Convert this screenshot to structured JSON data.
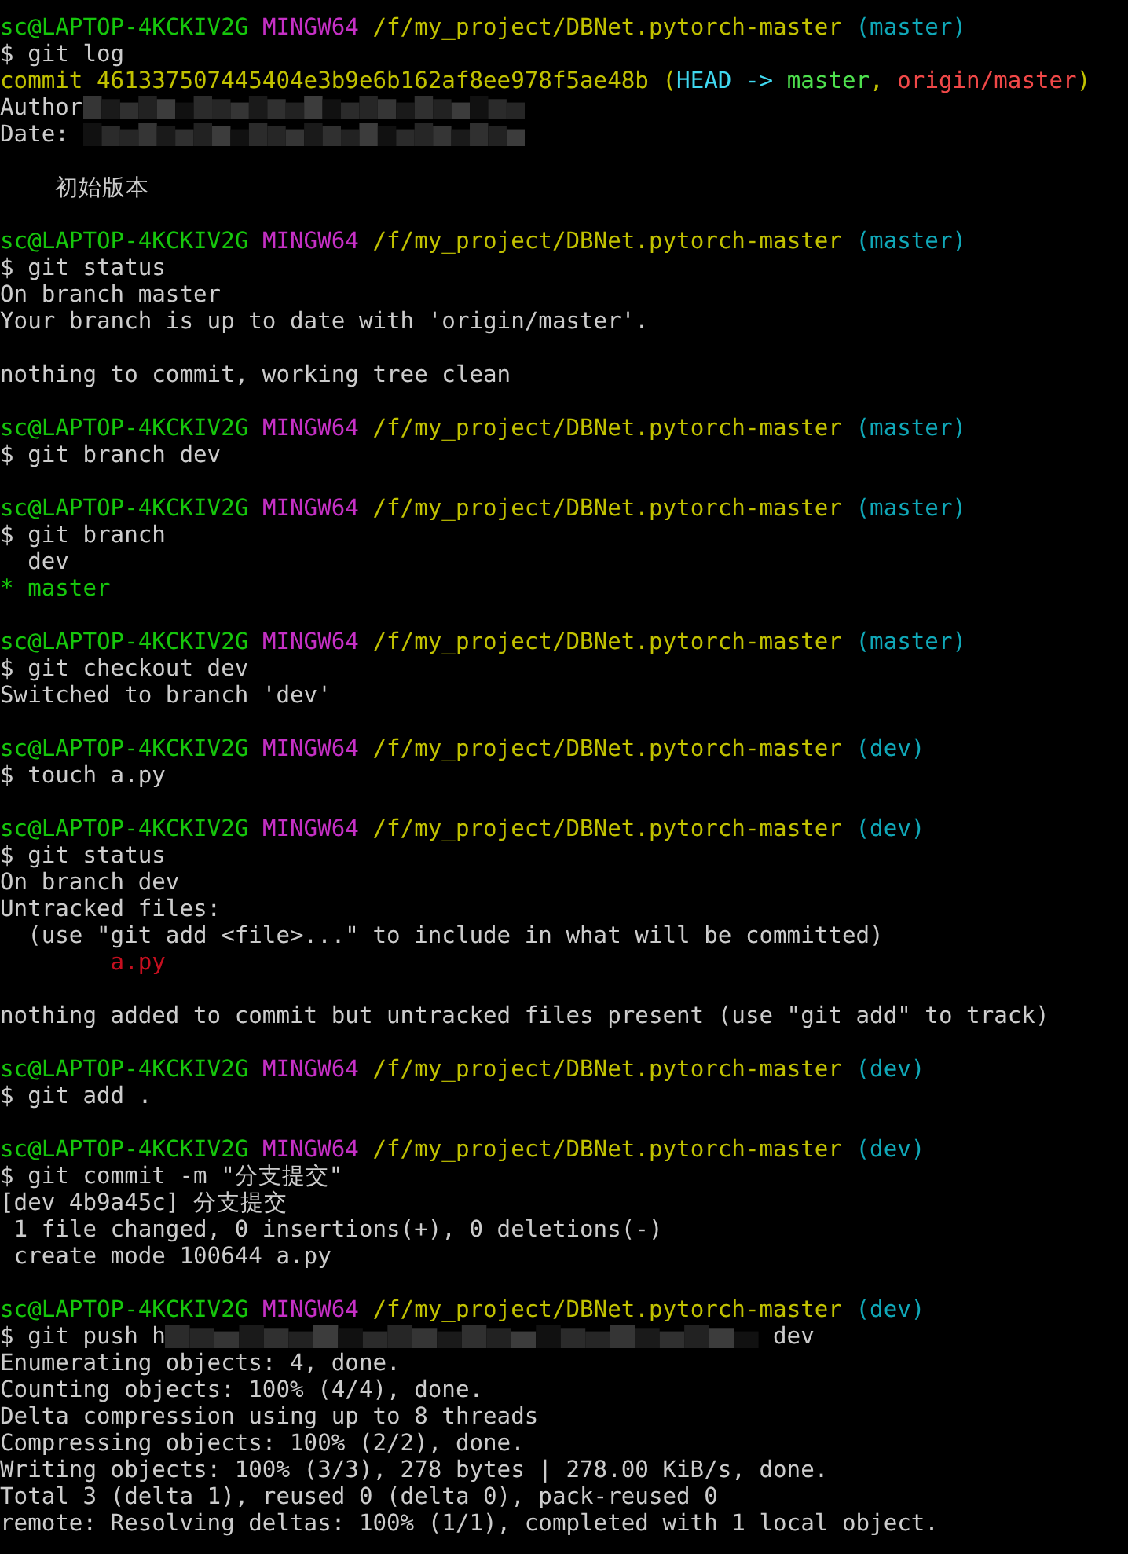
{
  "terminal": {
    "lines": [
      {
        "kind": "prompt",
        "user": "sc@LAPTOP-4KCKIV2G",
        "host": "MINGW64",
        "path": "/f/my_project/DBNet.pytorch-master",
        "branch": "(master)"
      },
      {
        "kind": "output",
        "segments": [
          {
            "kind": "command",
            "text": "$ git log"
          }
        ]
      },
      {
        "kind": "output",
        "segments": [
          {
            "kind": "commit",
            "text": "commit 461337507445404e3b9e6b162af8ee978f5ae48b ("
          },
          {
            "kind": "head",
            "text": "HEAD -> "
          },
          {
            "kind": "local-branch",
            "text": "master"
          },
          {
            "kind": "commit",
            "text": ", "
          },
          {
            "kind": "remote-branch",
            "text": "origin/master"
          },
          {
            "kind": "commit",
            "text": ")"
          }
        ]
      },
      {
        "kind": "output",
        "segments": [
          {
            "kind": "plain",
            "text": "Author"
          },
          {
            "kind": "redacted",
            "wide": false
          }
        ]
      },
      {
        "kind": "output",
        "segments": [
          {
            "kind": "plain",
            "text": "Date: "
          },
          {
            "kind": "redacted",
            "wide": false
          }
        ]
      },
      {
        "kind": "blank"
      },
      {
        "kind": "output",
        "segments": [
          {
            "kind": "plain",
            "text": "    初始版本"
          }
        ]
      },
      {
        "kind": "blank"
      },
      {
        "kind": "prompt",
        "user": "sc@LAPTOP-4KCKIV2G",
        "host": "MINGW64",
        "path": "/f/my_project/DBNet.pytorch-master",
        "branch": "(master)"
      },
      {
        "kind": "output",
        "segments": [
          {
            "kind": "command",
            "text": "$ git status"
          }
        ]
      },
      {
        "kind": "output",
        "segments": [
          {
            "kind": "plain",
            "text": "On branch master"
          }
        ]
      },
      {
        "kind": "output",
        "segments": [
          {
            "kind": "plain",
            "text": "Your branch is up to date with 'origin/master'."
          }
        ]
      },
      {
        "kind": "blank"
      },
      {
        "kind": "output",
        "segments": [
          {
            "kind": "plain",
            "text": "nothing to commit, working tree clean"
          }
        ]
      },
      {
        "kind": "blank"
      },
      {
        "kind": "prompt",
        "user": "sc@LAPTOP-4KCKIV2G",
        "host": "MINGW64",
        "path": "/f/my_project/DBNet.pytorch-master",
        "branch": "(master)"
      },
      {
        "kind": "output",
        "segments": [
          {
            "kind": "command",
            "text": "$ git branch dev"
          }
        ]
      },
      {
        "kind": "blank"
      },
      {
        "kind": "prompt",
        "user": "sc@LAPTOP-4KCKIV2G",
        "host": "MINGW64",
        "path": "/f/my_project/DBNet.pytorch-master",
        "branch": "(master)"
      },
      {
        "kind": "output",
        "segments": [
          {
            "kind": "command",
            "text": "$ git branch"
          }
        ]
      },
      {
        "kind": "output",
        "segments": [
          {
            "kind": "plain",
            "text": "  dev"
          }
        ]
      },
      {
        "kind": "output",
        "segments": [
          {
            "kind": "current-branch",
            "text": "* master"
          }
        ]
      },
      {
        "kind": "blank"
      },
      {
        "kind": "prompt",
        "user": "sc@LAPTOP-4KCKIV2G",
        "host": "MINGW64",
        "path": "/f/my_project/DBNet.pytorch-master",
        "branch": "(master)"
      },
      {
        "kind": "output",
        "segments": [
          {
            "kind": "command",
            "text": "$ git checkout dev"
          }
        ]
      },
      {
        "kind": "output",
        "segments": [
          {
            "kind": "plain",
            "text": "Switched to branch 'dev'"
          }
        ]
      },
      {
        "kind": "blank"
      },
      {
        "kind": "prompt",
        "user": "sc@LAPTOP-4KCKIV2G",
        "host": "MINGW64",
        "path": "/f/my_project/DBNet.pytorch-master",
        "branch": "(dev)"
      },
      {
        "kind": "output",
        "segments": [
          {
            "kind": "command",
            "text": "$ touch a.py"
          }
        ]
      },
      {
        "kind": "blank"
      },
      {
        "kind": "prompt",
        "user": "sc@LAPTOP-4KCKIV2G",
        "host": "MINGW64",
        "path": "/f/my_project/DBNet.pytorch-master",
        "branch": "(dev)"
      },
      {
        "kind": "output",
        "segments": [
          {
            "kind": "command",
            "text": "$ git status"
          }
        ]
      },
      {
        "kind": "output",
        "segments": [
          {
            "kind": "plain",
            "text": "On branch dev"
          }
        ]
      },
      {
        "kind": "output",
        "segments": [
          {
            "kind": "plain",
            "text": "Untracked files:"
          }
        ]
      },
      {
        "kind": "output",
        "segments": [
          {
            "kind": "plain",
            "text": "  (use \"git add <file>...\" to include in what will be committed)"
          }
        ]
      },
      {
        "kind": "output",
        "segments": [
          {
            "kind": "untracked",
            "text": "        a.py"
          }
        ]
      },
      {
        "kind": "blank"
      },
      {
        "kind": "output",
        "segments": [
          {
            "kind": "plain",
            "text": "nothing added to commit but untracked files present (use \"git add\" to track)"
          }
        ]
      },
      {
        "kind": "blank"
      },
      {
        "kind": "prompt",
        "user": "sc@LAPTOP-4KCKIV2G",
        "host": "MINGW64",
        "path": "/f/my_project/DBNet.pytorch-master",
        "branch": "(dev)"
      },
      {
        "kind": "output",
        "segments": [
          {
            "kind": "command",
            "text": "$ git add ."
          }
        ]
      },
      {
        "kind": "blank"
      },
      {
        "kind": "prompt",
        "user": "sc@LAPTOP-4KCKIV2G",
        "host": "MINGW64",
        "path": "/f/my_project/DBNet.pytorch-master",
        "branch": "(dev)"
      },
      {
        "kind": "output",
        "segments": [
          {
            "kind": "command",
            "text": "$ git commit -m \"分支提交\""
          }
        ]
      },
      {
        "kind": "output",
        "segments": [
          {
            "kind": "plain",
            "text": "[dev 4b9a45c] 分支提交"
          }
        ]
      },
      {
        "kind": "output",
        "segments": [
          {
            "kind": "plain",
            "text": " 1 file changed, 0 insertions(+), 0 deletions(-)"
          }
        ]
      },
      {
        "kind": "output",
        "segments": [
          {
            "kind": "plain",
            "text": " create mode 100644 a.py"
          }
        ]
      },
      {
        "kind": "blank"
      },
      {
        "kind": "prompt",
        "user": "sc@LAPTOP-4KCKIV2G",
        "host": "MINGW64",
        "path": "/f/my_project/DBNet.pytorch-master",
        "branch": "(dev)"
      },
      {
        "kind": "output",
        "segments": [
          {
            "kind": "command",
            "text": "$ git push h"
          },
          {
            "kind": "redacted",
            "wide": true
          },
          {
            "kind": "plain",
            "text": " dev"
          }
        ]
      },
      {
        "kind": "output",
        "segments": [
          {
            "kind": "plain",
            "text": "Enumerating objects: 4, done."
          }
        ]
      },
      {
        "kind": "output",
        "segments": [
          {
            "kind": "plain",
            "text": "Counting objects: 100% (4/4), done."
          }
        ]
      },
      {
        "kind": "output",
        "segments": [
          {
            "kind": "plain",
            "text": "Delta compression using up to 8 threads"
          }
        ]
      },
      {
        "kind": "output",
        "segments": [
          {
            "kind": "plain",
            "text": "Compressing objects: 100% (2/2), done."
          }
        ]
      },
      {
        "kind": "output",
        "segments": [
          {
            "kind": "plain",
            "text": "Writing objects: 100% (3/3), 278 bytes | 278.00 KiB/s, done."
          }
        ]
      },
      {
        "kind": "output",
        "segments": [
          {
            "kind": "plain",
            "text": "Total 3 (delta 1), reused 0 (delta 0), pack-reused 0"
          }
        ]
      },
      {
        "kind": "output",
        "segments": [
          {
            "kind": "plain",
            "text": "remote: Resolving deltas: 100% (1/1), completed with 1 local object."
          }
        ]
      }
    ]
  }
}
